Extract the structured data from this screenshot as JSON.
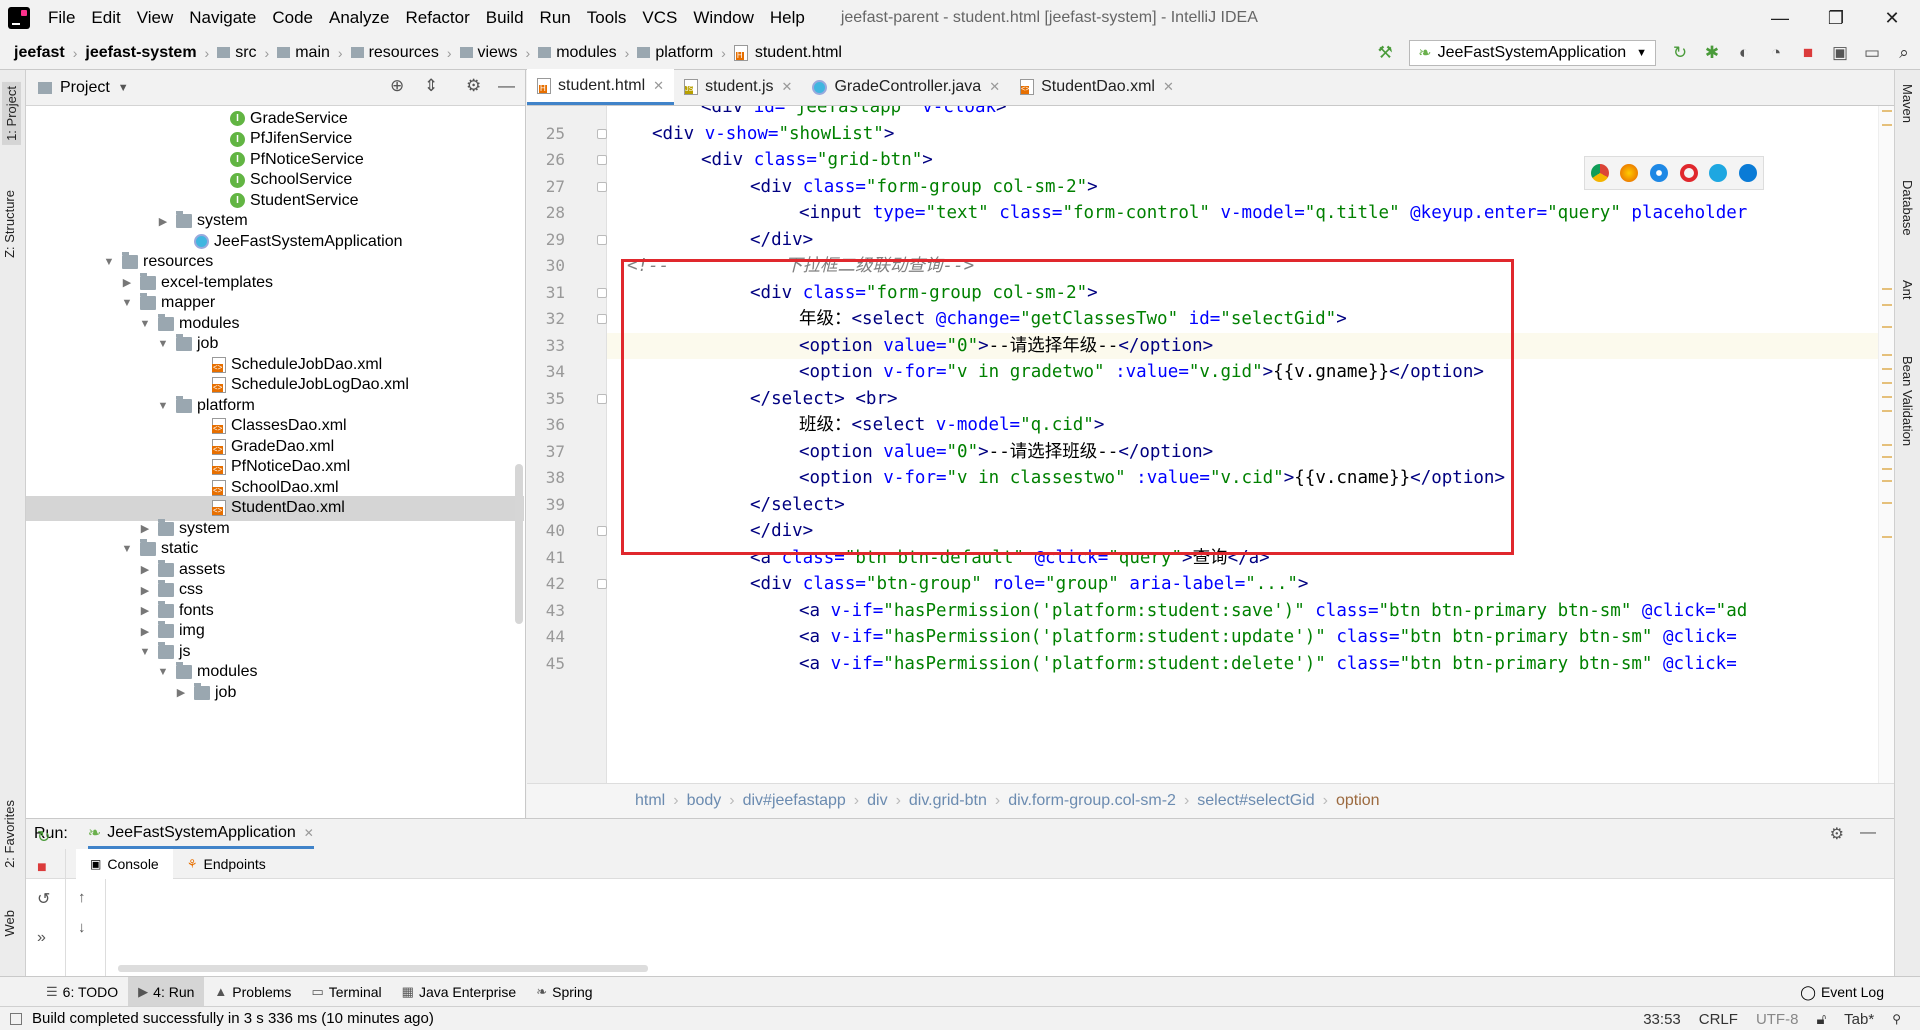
{
  "menubar": {
    "items": [
      "File",
      "Edit",
      "View",
      "Navigate",
      "Code",
      "Analyze",
      "Refactor",
      "Build",
      "Run",
      "Tools",
      "VCS",
      "Window",
      "Help"
    ],
    "window_title": "jeefast-parent - student.html [jeefast-system] - IntelliJ IDEA"
  },
  "navbar": {
    "crumbs": [
      "jeefast",
      "jeefast-system",
      "src",
      "main",
      "resources",
      "views",
      "modules",
      "platform",
      "student.html"
    ],
    "run_config": "JeeFastSystemApplication"
  },
  "left_strip": {
    "project": "1: Project",
    "structure": "Z: Structure",
    "favorites": "2: Favorites",
    "web": "Web"
  },
  "right_strip": {
    "maven": "Maven",
    "database": "Database",
    "ant": "Ant",
    "bean": "Bean Validation"
  },
  "project": {
    "title": "Project",
    "tree": [
      {
        "label": "GradeService",
        "indent": 10,
        "icon": "iface",
        "arrow": ""
      },
      {
        "label": "PfJifenService",
        "indent": 10,
        "icon": "iface",
        "arrow": ""
      },
      {
        "label": "PfNoticeService",
        "indent": 10,
        "icon": "iface",
        "arrow": ""
      },
      {
        "label": "SchoolService",
        "indent": 10,
        "icon": "iface",
        "arrow": ""
      },
      {
        "label": "StudentService",
        "indent": 10,
        "icon": "iface",
        "arrow": ""
      },
      {
        "label": "system",
        "indent": 7,
        "icon": "folder",
        "arrow": "▶"
      },
      {
        "label": "JeeFastSystemApplication",
        "indent": 8,
        "icon": "class",
        "arrow": ""
      },
      {
        "label": "resources",
        "indent": 4,
        "icon": "folder",
        "arrow": "▼"
      },
      {
        "label": "excel-templates",
        "indent": 5,
        "icon": "folder",
        "arrow": "▶"
      },
      {
        "label": "mapper",
        "indent": 5,
        "icon": "folder",
        "arrow": "▼"
      },
      {
        "label": "modules",
        "indent": 6,
        "icon": "folder",
        "arrow": "▼"
      },
      {
        "label": "job",
        "indent": 7,
        "icon": "folder",
        "arrow": "▼"
      },
      {
        "label": "ScheduleJobDao.xml",
        "indent": 9,
        "icon": "xml",
        "arrow": ""
      },
      {
        "label": "ScheduleJobLogDao.xml",
        "indent": 9,
        "icon": "xml",
        "arrow": ""
      },
      {
        "label": "platform",
        "indent": 7,
        "icon": "folder",
        "arrow": "▼"
      },
      {
        "label": "ClassesDao.xml",
        "indent": 9,
        "icon": "xml",
        "arrow": ""
      },
      {
        "label": "GradeDao.xml",
        "indent": 9,
        "icon": "xml",
        "arrow": ""
      },
      {
        "label": "PfNoticeDao.xml",
        "indent": 9,
        "icon": "xml",
        "arrow": ""
      },
      {
        "label": "SchoolDao.xml",
        "indent": 9,
        "icon": "xml",
        "arrow": ""
      },
      {
        "label": "StudentDao.xml",
        "indent": 9,
        "icon": "xml",
        "arrow": "",
        "selected": true
      },
      {
        "label": "system",
        "indent": 6,
        "icon": "folder",
        "arrow": "▶"
      },
      {
        "label": "static",
        "indent": 5,
        "icon": "folder",
        "arrow": "▼"
      },
      {
        "label": "assets",
        "indent": 6,
        "icon": "folder",
        "arrow": "▶"
      },
      {
        "label": "css",
        "indent": 6,
        "icon": "folder",
        "arrow": "▶"
      },
      {
        "label": "fonts",
        "indent": 6,
        "icon": "folder",
        "arrow": "▶"
      },
      {
        "label": "img",
        "indent": 6,
        "icon": "folder",
        "arrow": "▶"
      },
      {
        "label": "js",
        "indent": 6,
        "icon": "folder",
        "arrow": "▼"
      },
      {
        "label": "modules",
        "indent": 7,
        "icon": "folder",
        "arrow": "▼"
      },
      {
        "label": "job",
        "indent": 8,
        "icon": "folder",
        "arrow": "▶"
      }
    ]
  },
  "editor": {
    "tabs": [
      {
        "label": "student.html",
        "icon": "html",
        "active": true
      },
      {
        "label": "student.js",
        "icon": "js",
        "active": false
      },
      {
        "label": "GradeController.java",
        "icon": "java",
        "active": false
      },
      {
        "label": "StudentDao.xml",
        "icon": "xml",
        "active": false
      }
    ],
    "current_line": 33,
    "lines": [
      {
        "n": "",
        "indent": 2,
        "tokens": [
          [
            "tag",
            "<div "
          ],
          [
            "attr",
            "id="
          ],
          [
            "str",
            "\"jeefastapp\""
          ],
          [
            "attr",
            " v-cloak"
          ],
          [
            "tag",
            ">"
          ]
        ]
      },
      {
        "n": "25",
        "indent": 1,
        "tokens": [
          [
            "tag",
            "<div "
          ],
          [
            "attr",
            "v-show="
          ],
          [
            "str",
            "\"showList\""
          ],
          [
            "tag",
            ">"
          ]
        ]
      },
      {
        "n": "26",
        "indent": 2,
        "tokens": [
          [
            "tag",
            "<div "
          ],
          [
            "attr",
            "class="
          ],
          [
            "str",
            "\"grid-btn\""
          ],
          [
            "tag",
            ">"
          ]
        ]
      },
      {
        "n": "27",
        "indent": 3,
        "tokens": [
          [
            "tag",
            "<div "
          ],
          [
            "attr",
            "class="
          ],
          [
            "str",
            "\"form-group col-sm-2\""
          ],
          [
            "tag",
            ">"
          ]
        ]
      },
      {
        "n": "28",
        "indent": 4,
        "tokens": [
          [
            "tag",
            "<input "
          ],
          [
            "attr",
            "type="
          ],
          [
            "str",
            "\"text\""
          ],
          [
            "attr",
            " class="
          ],
          [
            "str",
            "\"form-control\""
          ],
          [
            "attr",
            " v-model="
          ],
          [
            "str",
            "\"q.title\""
          ],
          [
            "attr",
            " @keyup.enter="
          ],
          [
            "str",
            "\"query\""
          ],
          [
            "attr",
            " placeholder"
          ]
        ]
      },
      {
        "n": "29",
        "indent": 3,
        "tokens": [
          [
            "tag",
            "</div>"
          ]
        ]
      },
      {
        "n": "30",
        "indent": 0,
        "tokens": [
          [
            "cmt",
            "<!--           下拉框二级联动查询-->"
          ]
        ]
      },
      {
        "n": "31",
        "indent": 3,
        "tokens": [
          [
            "tag",
            "<div "
          ],
          [
            "attr",
            "class="
          ],
          [
            "str",
            "\"form-group col-sm-2\""
          ],
          [
            "tag",
            ">"
          ]
        ]
      },
      {
        "n": "32",
        "indent": 4,
        "tokens": [
          [
            "plain",
            "年级："
          ],
          [
            "tag",
            "<select "
          ],
          [
            "attr",
            "@change="
          ],
          [
            "str",
            "\"getClassesTwo\""
          ],
          [
            "attr",
            " id="
          ],
          [
            "str",
            "\"selectGid\""
          ],
          [
            "tag",
            ">"
          ]
        ]
      },
      {
        "n": "33",
        "indent": 4,
        "tokens": [
          [
            "tag",
            "<option "
          ],
          [
            "attr",
            "value="
          ],
          [
            "str",
            "\"0\""
          ],
          [
            "tag",
            ">"
          ],
          [
            "plain",
            "--请选择年级--"
          ],
          [
            "tag",
            "</option>"
          ]
        ]
      },
      {
        "n": "34",
        "indent": 4,
        "tokens": [
          [
            "tag",
            "<option "
          ],
          [
            "attr",
            "v-for="
          ],
          [
            "str",
            "\"v in gradetwo\""
          ],
          [
            "attr",
            " :value="
          ],
          [
            "str",
            "\"v.gid\""
          ],
          [
            "tag",
            ">"
          ],
          [
            "plain",
            "{{v.gname}}"
          ],
          [
            "tag",
            "</option>"
          ]
        ]
      },
      {
        "n": "35",
        "indent": 3,
        "tokens": [
          [
            "tag",
            "</select>"
          ],
          [
            "plain",
            " "
          ],
          [
            "tag",
            "<br>"
          ]
        ]
      },
      {
        "n": "36",
        "indent": 4,
        "tokens": [
          [
            "plain",
            "班级："
          ],
          [
            "tag",
            "<select "
          ],
          [
            "attr",
            "v-model="
          ],
          [
            "str",
            "\"q.cid\""
          ],
          [
            "tag",
            ">"
          ]
        ]
      },
      {
        "n": "37",
        "indent": 4,
        "tokens": [
          [
            "tag",
            "<option "
          ],
          [
            "attr",
            "value="
          ],
          [
            "str",
            "\"0\""
          ],
          [
            "tag",
            ">"
          ],
          [
            "plain",
            "--请选择班级--"
          ],
          [
            "tag",
            "</option>"
          ]
        ]
      },
      {
        "n": "38",
        "indent": 4,
        "tokens": [
          [
            "tag",
            "<option "
          ],
          [
            "attr",
            "v-for="
          ],
          [
            "str",
            "\"v in classestwo\""
          ],
          [
            "attr",
            " :value="
          ],
          [
            "str",
            "\"v.cid\""
          ],
          [
            "tag",
            ">"
          ],
          [
            "plain",
            "{{v.cname}}"
          ],
          [
            "tag",
            "</option>"
          ]
        ]
      },
      {
        "n": "39",
        "indent": 3,
        "tokens": [
          [
            "tag",
            "</select>"
          ]
        ]
      },
      {
        "n": "40",
        "indent": 3,
        "tokens": [
          [
            "tag",
            "</div>"
          ]
        ]
      },
      {
        "n": "41",
        "indent": 3,
        "tokens": [
          [
            "tag",
            "<a "
          ],
          [
            "attr",
            "class="
          ],
          [
            "str",
            "\"btn btn-default\""
          ],
          [
            "attr",
            " @click="
          ],
          [
            "str",
            "\"query\""
          ],
          [
            "tag",
            ">"
          ],
          [
            "plain",
            "查询"
          ],
          [
            "tag",
            "</a>"
          ]
        ]
      },
      {
        "n": "42",
        "indent": 3,
        "tokens": [
          [
            "tag",
            "<div "
          ],
          [
            "attr",
            "class="
          ],
          [
            "str",
            "\"btn-group\""
          ],
          [
            "attr",
            " role="
          ],
          [
            "str",
            "\"group\""
          ],
          [
            "attr",
            " aria-label="
          ],
          [
            "str",
            "\"...\""
          ],
          [
            "tag",
            ">"
          ]
        ]
      },
      {
        "n": "43",
        "indent": 4,
        "tokens": [
          [
            "tag",
            "<a "
          ],
          [
            "attr",
            "v-if="
          ],
          [
            "str",
            "\"hasPermission('platform:student:save')\""
          ],
          [
            "attr",
            " class="
          ],
          [
            "str",
            "\"btn btn-primary btn-sm\""
          ],
          [
            "attr",
            " @click="
          ],
          [
            "str",
            "\"ad"
          ]
        ]
      },
      {
        "n": "44",
        "indent": 4,
        "tokens": [
          [
            "tag",
            "<a "
          ],
          [
            "attr",
            "v-if="
          ],
          [
            "str",
            "\"hasPermission('platform:student:update')\""
          ],
          [
            "attr",
            " class="
          ],
          [
            "str",
            "\"btn btn-primary btn-sm\""
          ],
          [
            "attr",
            " @click="
          ]
        ]
      },
      {
        "n": "45",
        "indent": 4,
        "tokens": [
          [
            "tag",
            "<a "
          ],
          [
            "attr",
            "v-if="
          ],
          [
            "str",
            "\"hasPermission('platform:student:delete')\""
          ],
          [
            "attr",
            " class="
          ],
          [
            "str",
            "\"btn btn-primary btn-sm\""
          ],
          [
            "attr",
            " @click="
          ]
        ]
      }
    ],
    "breadcrumbs": [
      "html",
      "body",
      "div#jeefastapp",
      "div",
      "div.grid-btn",
      "div.form-group.col-sm-2",
      "select#selectGid",
      "option"
    ]
  },
  "run": {
    "label": "Run:",
    "config": "JeeFastSystemApplication",
    "subtabs": [
      "Console",
      "Endpoints"
    ]
  },
  "bottom_tools": [
    {
      "label": "6: TODO",
      "icon": "☰"
    },
    {
      "label": "4: Run",
      "icon": "▶",
      "active": true
    },
    {
      "label": "Problems",
      "icon": "▲"
    },
    {
      "label": "Terminal",
      "icon": "▭"
    },
    {
      "label": "Java Enterprise",
      "icon": "▦"
    },
    {
      "label": "Spring",
      "icon": "❧"
    }
  ],
  "event_log": "Event Log",
  "status": {
    "message": "Build completed successfully in 3 s 336 ms (10 minutes ago)",
    "position": "33:53",
    "line_sep": "CRLF",
    "encoding": "UTF-8",
    "indent": "Tab*"
  },
  "colors": {
    "accent": "#4083c9",
    "highlight_box": "#e0282d",
    "tag": "#000080",
    "attr": "#0000ff",
    "string": "#008000"
  }
}
